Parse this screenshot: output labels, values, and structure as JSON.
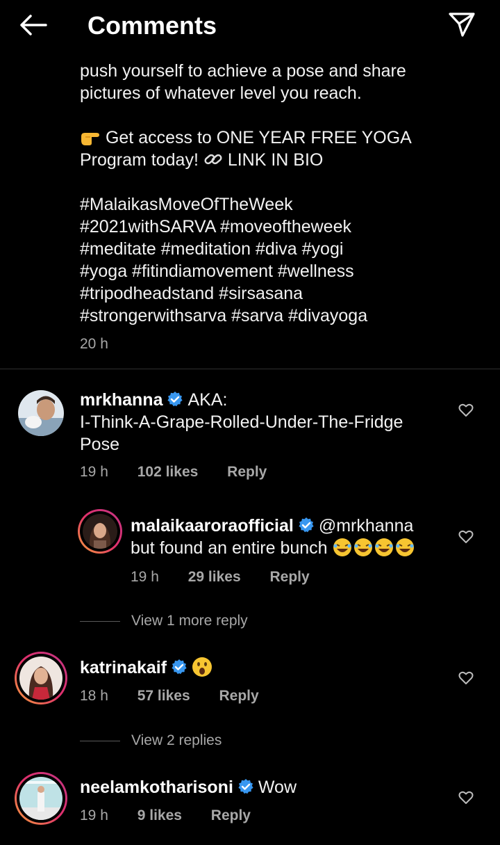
{
  "header": {
    "title": "Comments"
  },
  "caption": {
    "lines": [
      "push yourself to achieve a pose and share",
      "pictures of whatever level you reach."
    ],
    "promo_line1": "Get access to ONE YEAR FREE YOGA",
    "promo_line2_a": "Program today!",
    "promo_line2_b": "LINK IN BIO",
    "hashtags": [
      "#MalaikasMoveOfTheWeek",
      "#2021withSARVA #moveoftheweek",
      "#meditate #meditation #diva #yogi",
      "#yoga #fitindiamovement #wellness",
      "#tripodheadstand #sirsasana",
      "#strongerwithsarva #sarva #divayoga"
    ],
    "time": "20 h"
  },
  "comments": [
    {
      "user": "mrkhanna",
      "text_line1": "AKA:",
      "text_line2": "I-Think-A-Grape-Rolled-Under-The-Fridge",
      "text_line3": "Pose",
      "time": "19 h",
      "likes": "102 likes",
      "reply": "Reply"
    },
    {
      "user": "malaikaaroraofficial",
      "mention": "@mrkhanna",
      "text_line2": "but found an entire bunch",
      "time": "19 h",
      "likes": "29 likes",
      "reply": "Reply",
      "view_more": "View 1 more reply"
    },
    {
      "user": "katrinakaif",
      "time": "18 h",
      "likes": "57 likes",
      "reply": "Reply",
      "view_more": "View 2 replies"
    },
    {
      "user": "neelamkotharisoni",
      "text": "Wow",
      "time": "19 h",
      "likes": "9 likes",
      "reply": "Reply"
    }
  ],
  "colors": {
    "background": "#000000",
    "text": "#f2f2f2",
    "secondary": "#a8a8a8",
    "verified": "#3897f0"
  }
}
